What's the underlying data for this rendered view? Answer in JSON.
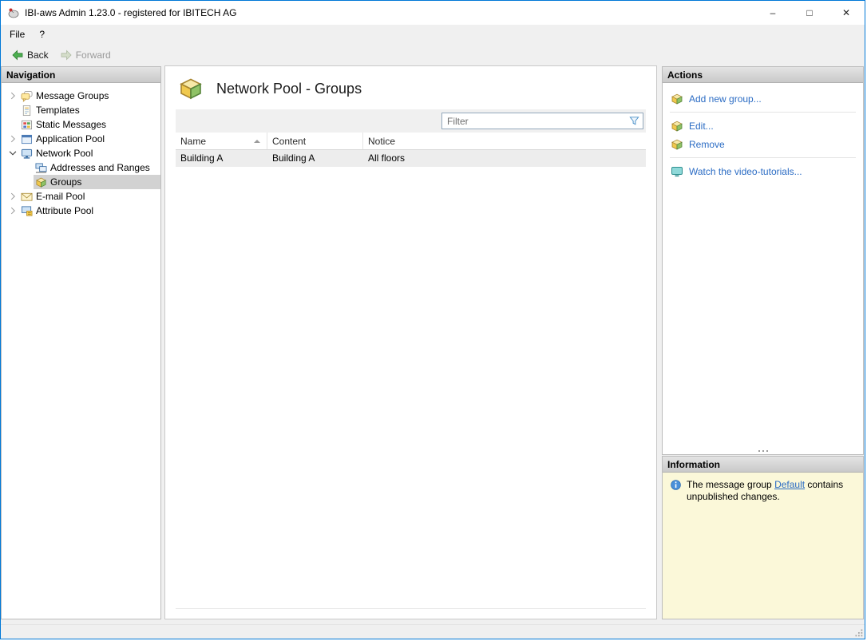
{
  "window": {
    "title": "IBI-aws Admin 1.23.0 - registered for IBITECH AG",
    "controls": {
      "minimize": "–",
      "maximize": "□",
      "close": "✕"
    }
  },
  "menubar": {
    "items": [
      "File",
      "?"
    ]
  },
  "toolbar": {
    "back": "Back",
    "forward": "Forward"
  },
  "navigation": {
    "header": "Navigation",
    "items": [
      {
        "label": "Message Groups"
      },
      {
        "label": "Templates"
      },
      {
        "label": "Static Messages"
      },
      {
        "label": "Application Pool"
      },
      {
        "label": "Network Pool"
      },
      {
        "label": "Addresses and Ranges"
      },
      {
        "label": "Groups"
      },
      {
        "label": "E-mail Pool"
      },
      {
        "label": "Attribute Pool"
      }
    ]
  },
  "main": {
    "title": "Network Pool - Groups",
    "filter": {
      "placeholder": "Filter"
    },
    "table": {
      "columns": [
        "Name",
        "Content",
        "Notice"
      ],
      "rows": [
        {
          "name": "Building A",
          "content": "Building A",
          "notice": "All floors"
        }
      ]
    }
  },
  "actions": {
    "header": "Actions",
    "add": "Add new group...",
    "edit": "Edit...",
    "remove": "Remove",
    "tutorials": "Watch the video-tutorials..."
  },
  "information": {
    "header": "Information",
    "message_before": "The message group ",
    "link": "Default",
    "message_after": " contains unpublished changes."
  }
}
